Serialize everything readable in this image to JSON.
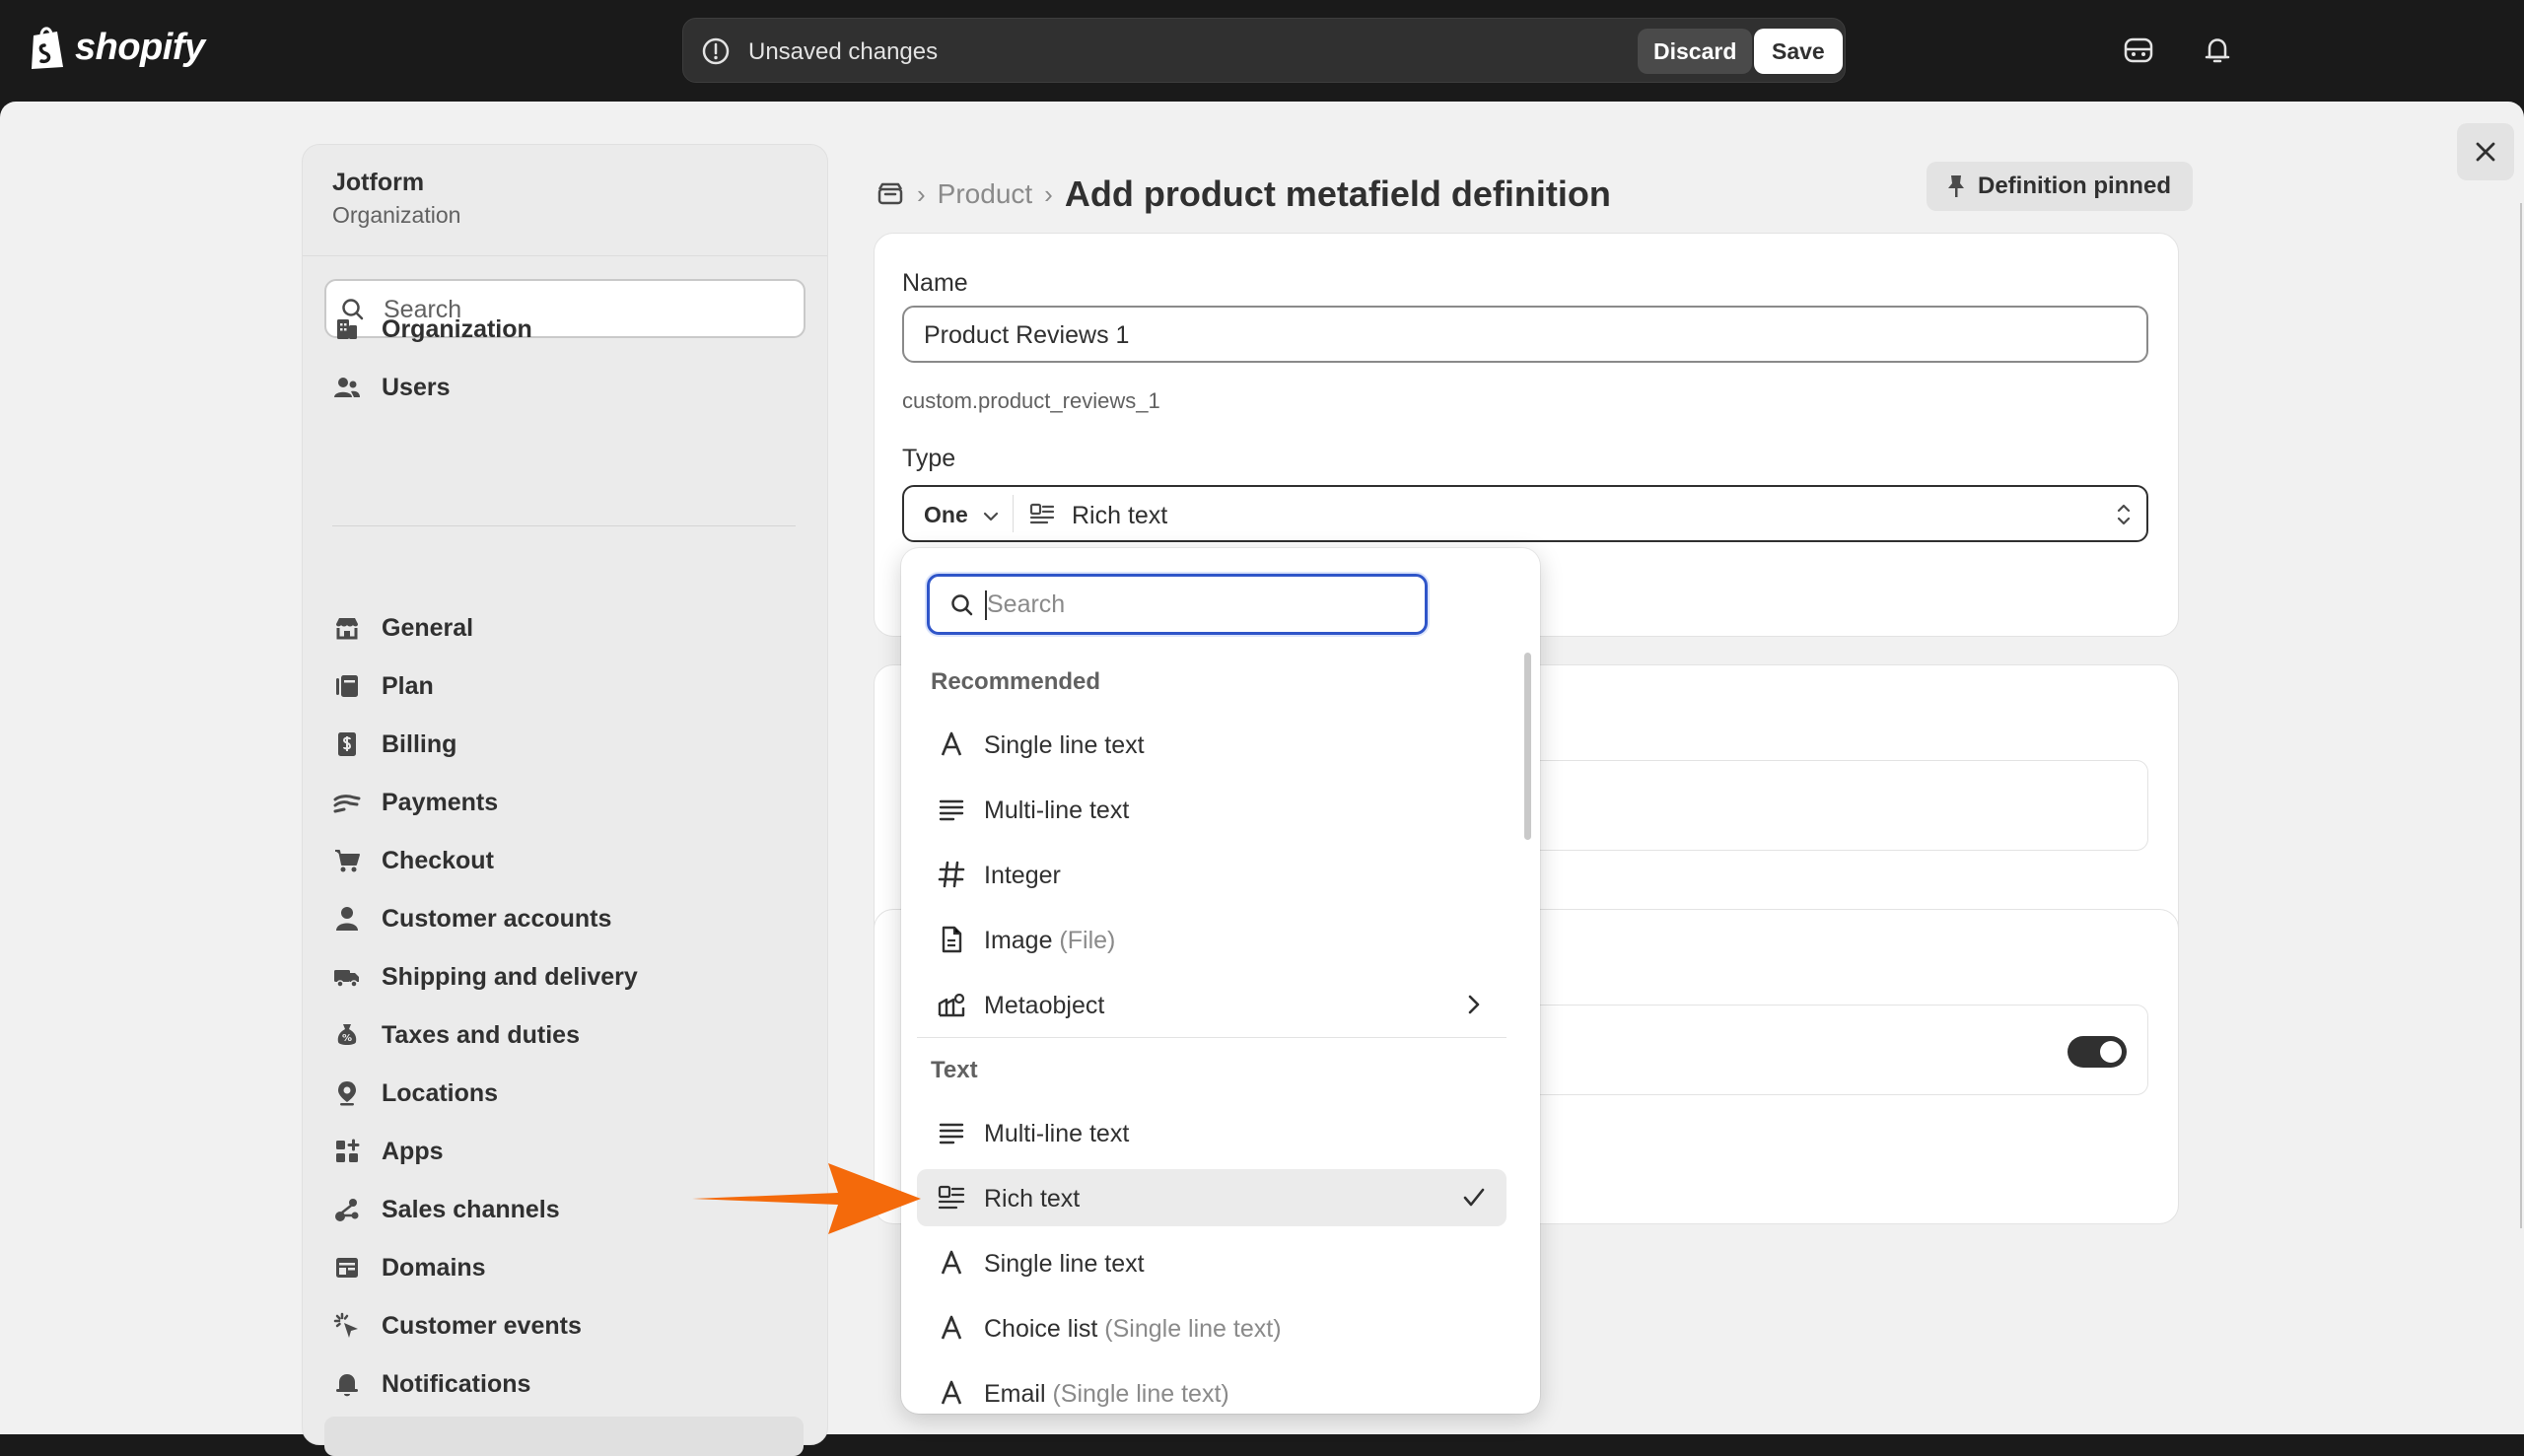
{
  "topbar": {
    "logo_text": "shopify",
    "unsaved_text": "Unsaved changes",
    "discard_label": "Discard",
    "save_label": "Save"
  },
  "sidebar": {
    "org_name": "Jotform",
    "org_sub": "Organization",
    "search_placeholder": "Search",
    "top_items": [
      {
        "label": "Organization",
        "icon": "building-icon"
      },
      {
        "label": "Users",
        "icon": "users-icon"
      }
    ],
    "items": [
      {
        "label": "General",
        "icon": "store-icon"
      },
      {
        "label": "Plan",
        "icon": "plan-icon"
      },
      {
        "label": "Billing",
        "icon": "billing-icon"
      },
      {
        "label": "Payments",
        "icon": "payments-icon"
      },
      {
        "label": "Checkout",
        "icon": "cart-icon"
      },
      {
        "label": "Customer accounts",
        "icon": "person-icon"
      },
      {
        "label": "Shipping and delivery",
        "icon": "truck-icon"
      },
      {
        "label": "Taxes and duties",
        "icon": "tax-icon"
      },
      {
        "label": "Locations",
        "icon": "location-icon"
      },
      {
        "label": "Apps",
        "icon": "apps-icon"
      },
      {
        "label": "Sales channels",
        "icon": "channels-icon"
      },
      {
        "label": "Domains",
        "icon": "globe-icon"
      },
      {
        "label": "Customer events",
        "icon": "cursor-icon"
      },
      {
        "label": "Notifications",
        "icon": "bell-icon"
      }
    ]
  },
  "breadcrumb": {
    "product": "Product",
    "title": "Add product metafield definition"
  },
  "pinned_label": "Definition pinned",
  "form": {
    "name_label": "Name",
    "name_value": "Product Reviews 1",
    "namespace": "custom.product_reviews_1",
    "type_label": "Type",
    "type_count": "One",
    "type_value": "Rich text"
  },
  "dropdown": {
    "search_placeholder": "Search",
    "recommended_header": "Recommended",
    "recommended": [
      {
        "label": "Single line text",
        "hint": "",
        "icon": "letter-a-icon"
      },
      {
        "label": "Multi-line text",
        "hint": "",
        "icon": "lines-icon"
      },
      {
        "label": "Integer",
        "hint": "",
        "icon": "hash-icon"
      },
      {
        "label": "Image",
        "hint": " (File)",
        "icon": "file-icon"
      },
      {
        "label": "Metaobject",
        "hint": "",
        "icon": "metaobject-icon"
      }
    ],
    "text_header": "Text",
    "text_items": [
      {
        "label": "Multi-line text",
        "hint": "",
        "icon": "lines-icon"
      },
      {
        "label": "Rich text",
        "hint": "",
        "icon": "rich-text-icon",
        "selected": true
      },
      {
        "label": "Single line text",
        "hint": "",
        "icon": "letter-a-icon"
      },
      {
        "label": "Choice list",
        "hint": " (Single line text)",
        "icon": "letter-a-icon"
      },
      {
        "label": "Email",
        "hint": " (Single line text)",
        "icon": "letter-a-icon"
      }
    ]
  },
  "colors": {
    "topbar_bg": "#1a1a1a",
    "page_bg": "#f1f1f1",
    "focus_ring": "#2f55c9",
    "arrow": "#f46a0b"
  }
}
